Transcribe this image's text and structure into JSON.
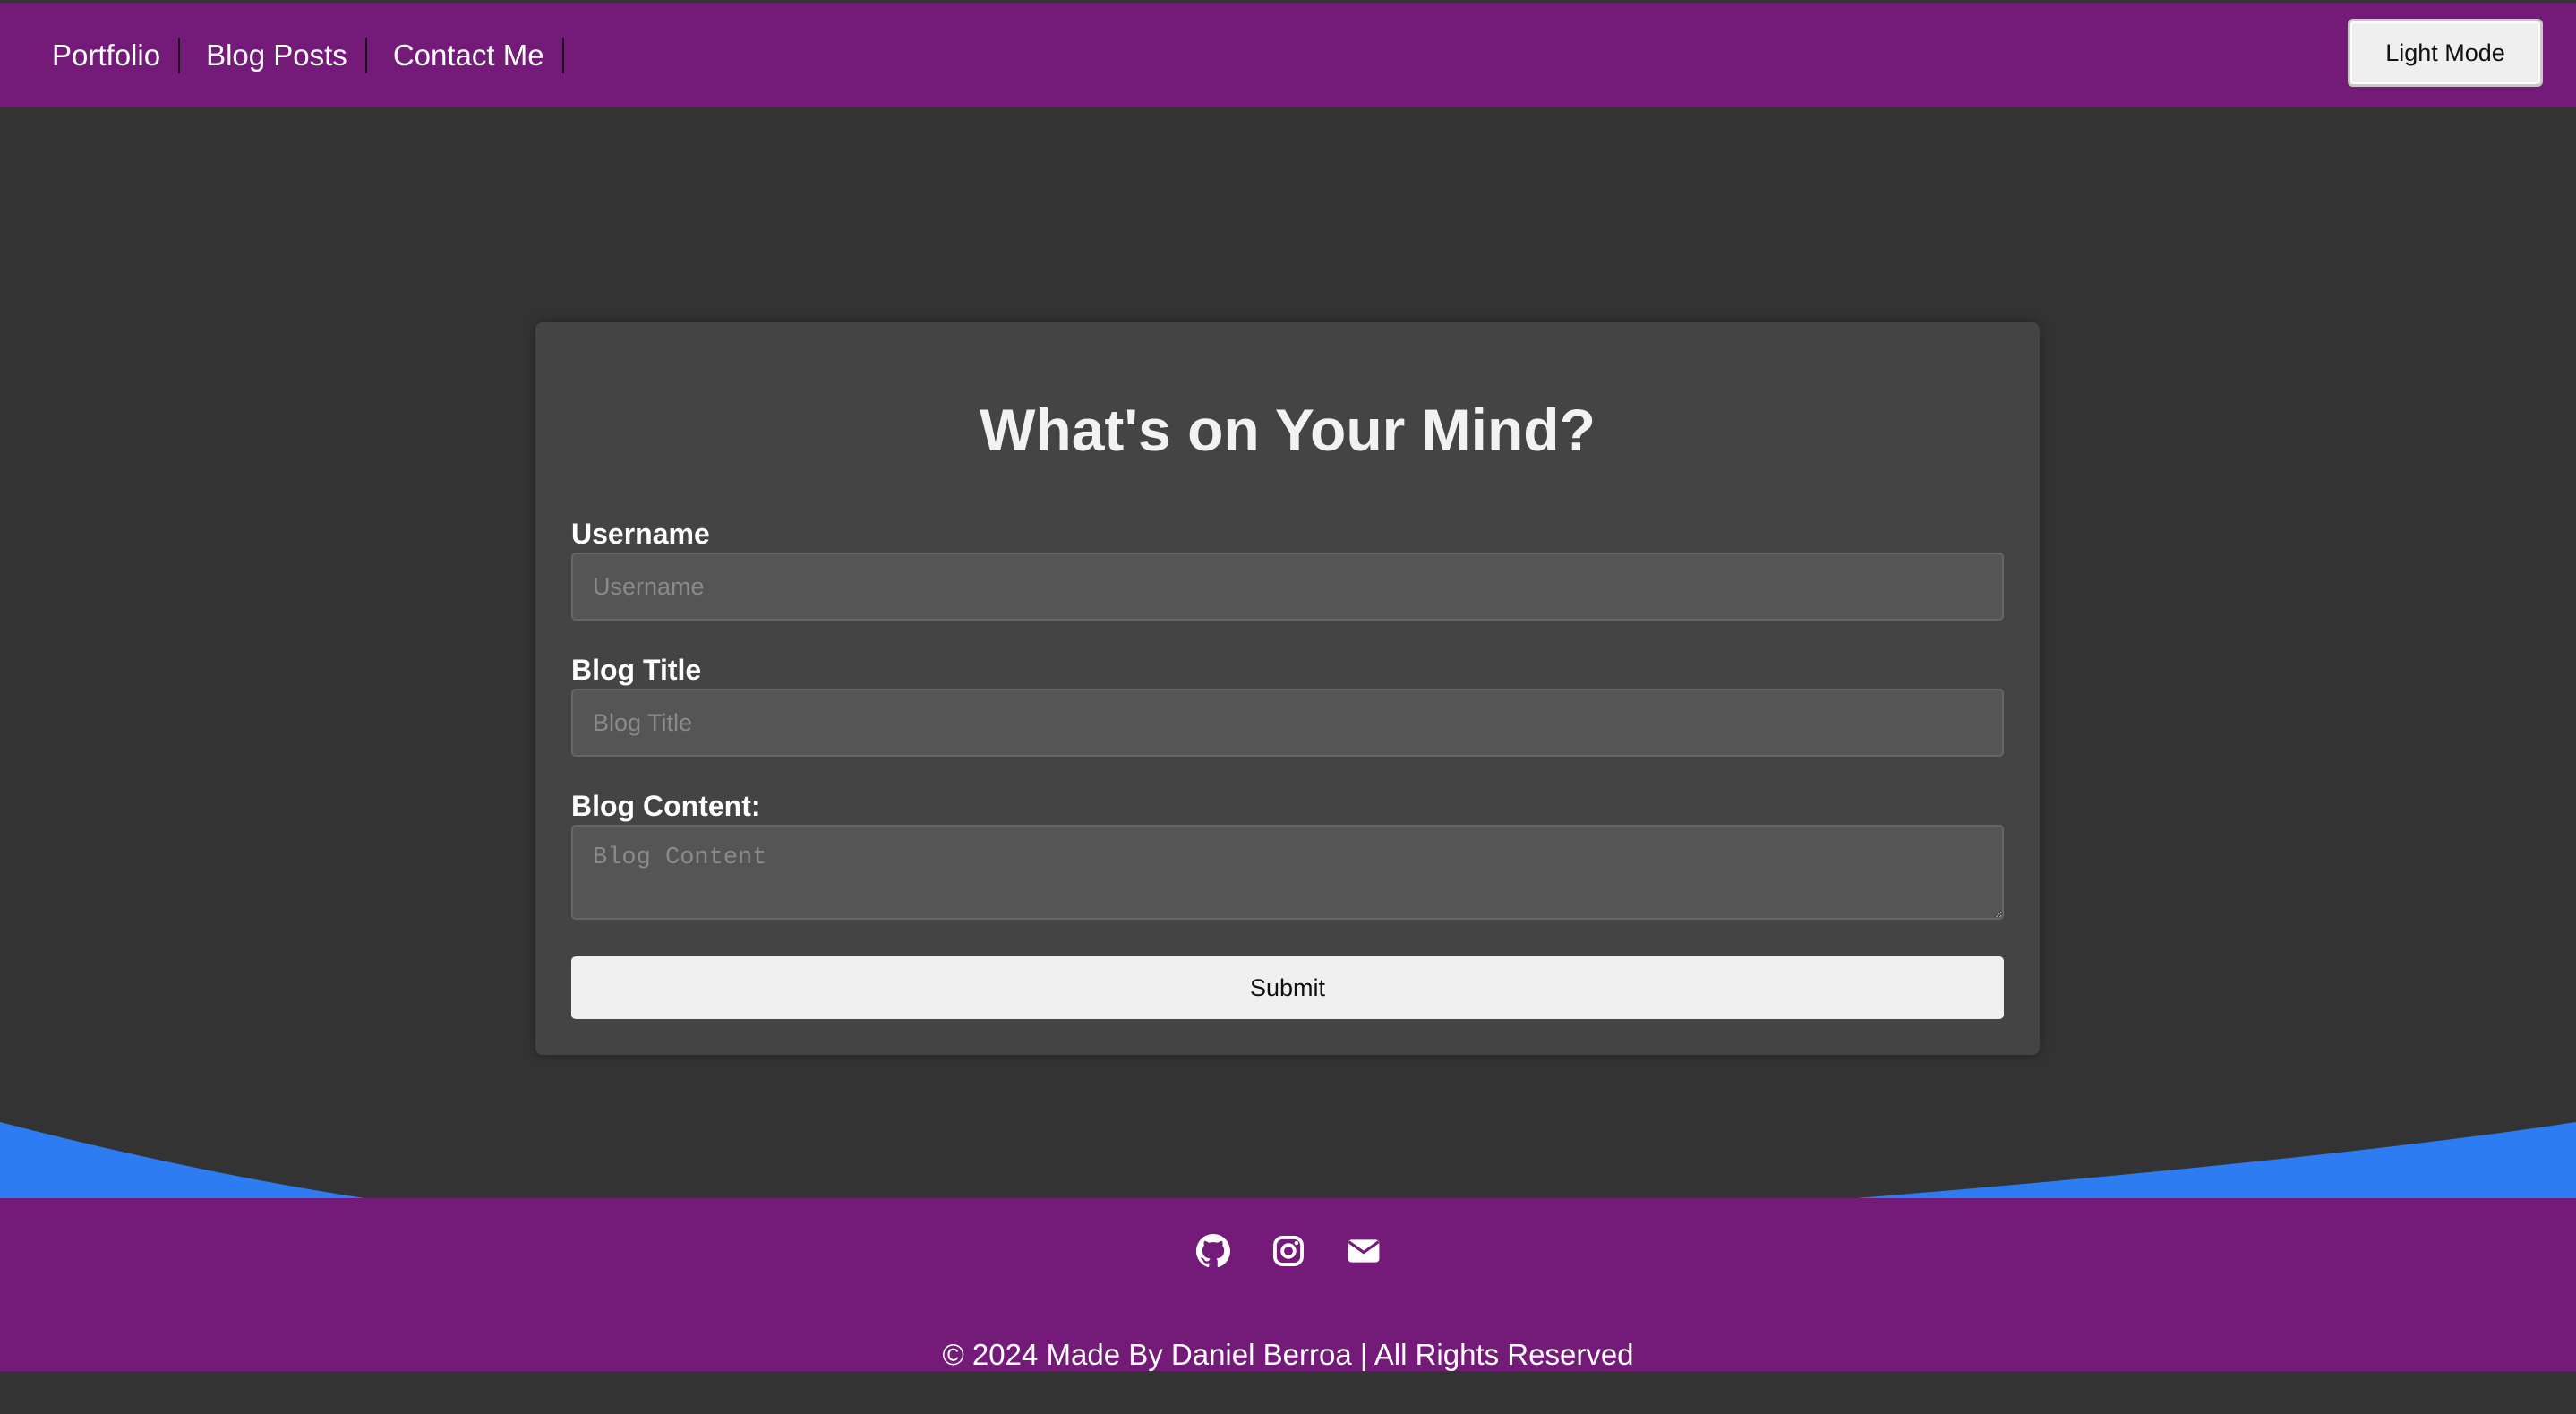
{
  "nav": {
    "links": [
      "Portfolio",
      "Blog Posts",
      "Contact Me"
    ],
    "mode_button": "Light Mode"
  },
  "form": {
    "title": "What's on Your Mind?",
    "username": {
      "label": "Username",
      "placeholder": "Username"
    },
    "blog_title": {
      "label": "Blog Title",
      "placeholder": "Blog Title"
    },
    "blog_content": {
      "label": "Blog Content:",
      "placeholder": "Blog Content"
    },
    "submit_label": "Submit"
  },
  "footer": {
    "social_icons": [
      "github-icon",
      "instagram-icon",
      "envelope-icon"
    ],
    "copyright": "© 2024 Made By Daniel Berroa | All Rights Reserved"
  },
  "colors": {
    "page_background": "#333333",
    "header_footer": "#741b7a",
    "card_background": "#444444",
    "input_background": "#555555",
    "wave": "#2d7cf2"
  }
}
